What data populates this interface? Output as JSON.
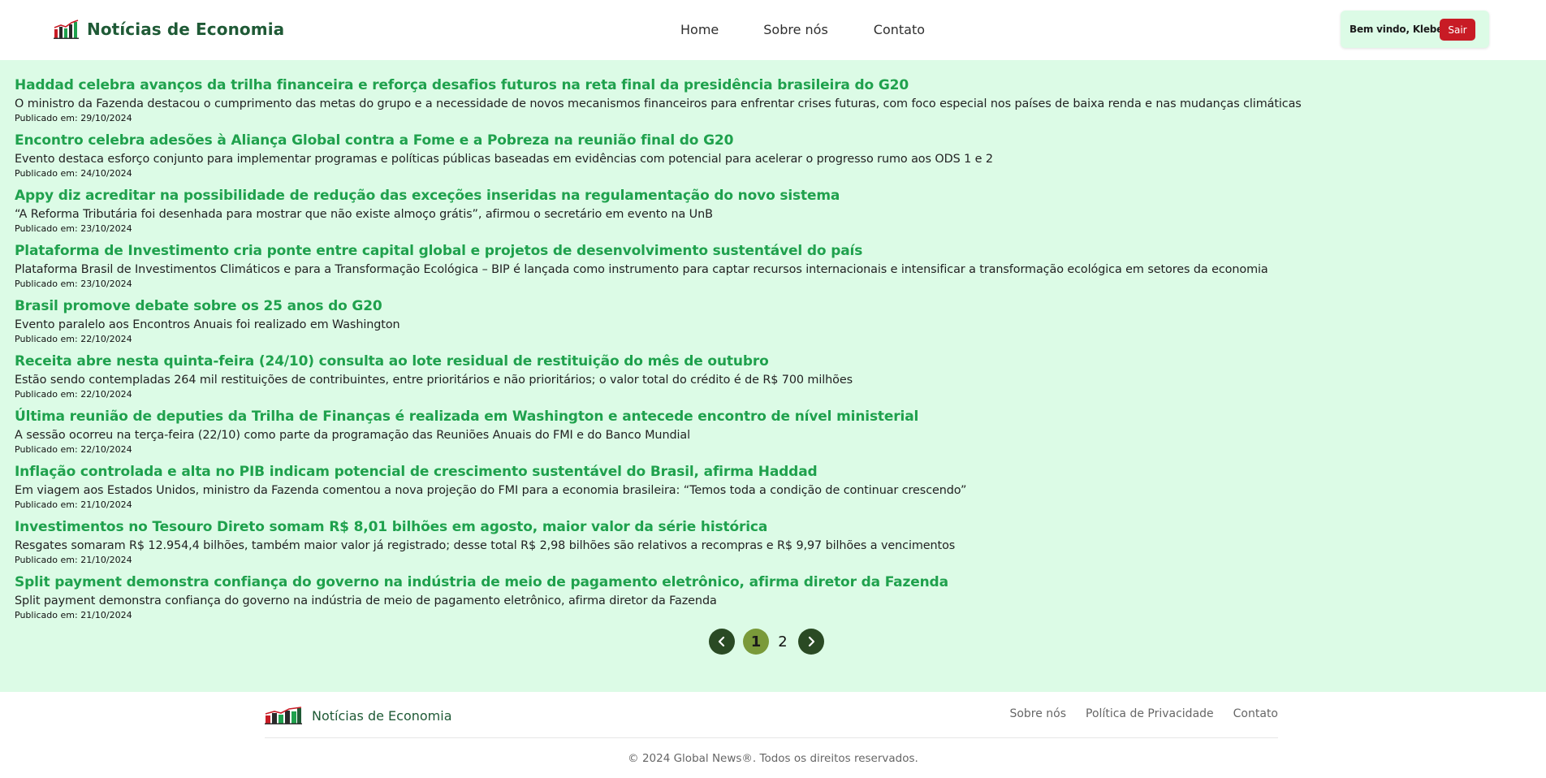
{
  "header": {
    "brand_title": "Notícias de Economia",
    "nav": [
      {
        "label": "Home"
      },
      {
        "label": "Sobre nós"
      },
      {
        "label": "Contato"
      }
    ],
    "welcome_text": "Bem vindo, Kleber",
    "logout_label": "Sair"
  },
  "news": [
    {
      "title": "Haddad celebra avanços da trilha financeira e reforça desafios futuros na reta final da presidência brasileira do G20",
      "summary": "O ministro da Fazenda destacou o cumprimento das metas do grupo e a necessidade de novos mecanismos financeiros para enfrentar crises futuras, com foco especial nos países de baixa renda e nas mudanças climáticas",
      "date": "Publicado em: 29/10/2024"
    },
    {
      "title": "Encontro celebra adesões à Aliança Global contra a Fome e a Pobreza na reunião final do G20",
      "summary": "Evento destaca esforço conjunto para implementar programas e políticas públicas baseadas em evidências com potencial para acelerar o progresso rumo aos ODS 1 e 2",
      "date": "Publicado em: 24/10/2024"
    },
    {
      "title": "Appy diz acreditar na possibilidade de redução das exceções inseridas na regulamentação do novo sistema",
      "summary": "“A Reforma Tributária foi desenhada para mostrar que não existe almoço grátis”, afirmou o secretário em evento na UnB",
      "date": "Publicado em: 23/10/2024"
    },
    {
      "title": "Plataforma de Investimento cria ponte entre capital global e projetos de desenvolvimento sustentável do país",
      "summary": "Plataforma Brasil de Investimentos Climáticos e para a Transformação Ecológica – BIP é lançada como instrumento para captar recursos internacionais e intensificar a transformação ecológica em setores da economia",
      "date": "Publicado em: 23/10/2024"
    },
    {
      "title": "Brasil promove debate sobre os 25 anos do G20",
      "summary": "Evento paralelo aos Encontros Anuais foi realizado em Washington",
      "date": "Publicado em: 22/10/2024"
    },
    {
      "title": "Receita abre nesta quinta-feira (24/10) consulta ao lote residual de restituição do mês de outubro",
      "summary": "Estão sendo contempladas 264 mil restituições de contribuintes, entre prioritários e não prioritários; o valor total do crédito é de R$ 700 milhões",
      "date": "Publicado em: 22/10/2024"
    },
    {
      "title": "Última reunião de deputies da Trilha de Finanças é realizada em Washington e antecede encontro de nível ministerial",
      "summary": "A sessão ocorreu na terça-feira (22/10) como parte da programação das Reuniões Anuais do FMI e do Banco Mundial",
      "date": "Publicado em: 22/10/2024"
    },
    {
      "title": "Inflação controlada e alta no PIB indicam potencial de crescimento sustentável do Brasil, afirma Haddad",
      "summary": "Em viagem aos Estados Unidos, ministro da Fazenda comentou a nova projeção do FMI para a economia brasileira: “Temos toda a condição de continuar crescendo”",
      "date": "Publicado em: 21/10/2024"
    },
    {
      "title": "Investimentos no Tesouro Direto somam R$ 8,01 bilhões em agosto, maior valor da série histórica",
      "summary": "Resgates somaram R$ 12.954,4 bilhões, também maior valor já registrado; desse total R$ 2,98 bilhões são relativos a recompras e R$ 9,97 bilhões a vencimentos",
      "date": "Publicado em: 21/10/2024"
    },
    {
      "title": "Split payment demonstra confiança do governo na indústria de meio de pagamento eletrônico, afirma diretor da Fazenda",
      "summary": "Split payment demonstra confiança do governo na indústria de meio de pagamento eletrônico, afirma diretor da Fazenda",
      "date": "Publicado em: 21/10/2024"
    }
  ],
  "pagination": {
    "prev_icon": "chevron-left-icon",
    "next_icon": "chevron-right-icon",
    "pages": [
      "1",
      "2"
    ],
    "current_page": "1"
  },
  "footer": {
    "brand_title": "Notícias de Economia",
    "links": [
      {
        "label": "Sobre nós"
      },
      {
        "label": "Política de Privacidade"
      },
      {
        "label": "Contato"
      }
    ],
    "copyright": "© 2024 Global News®. Todos os direitos reservados."
  },
  "colors": {
    "brand_green": "#1f5a36",
    "headline_green": "#1fa14d",
    "main_background": "#dcfbe6",
    "logout_red": "#c81b25",
    "pagination_dark": "#2a4a24",
    "pagination_active": "#7a9a3a"
  }
}
